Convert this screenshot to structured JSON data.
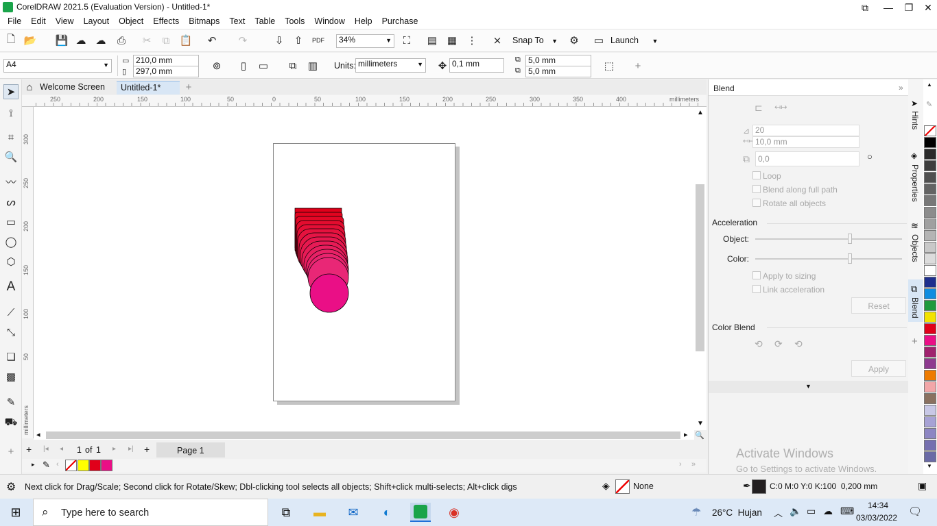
{
  "app": {
    "title": "CorelDRAW 2021.5 (Evaluation Version) - Untitled-1*",
    "brand_color": "#1aa44a"
  },
  "menu": [
    "File",
    "Edit",
    "View",
    "Layout",
    "Object",
    "Effects",
    "Bitmaps",
    "Text",
    "Table",
    "Tools",
    "Window",
    "Help",
    "Purchase"
  ],
  "toolbar": {
    "zoom": "34%",
    "snap_to": "Snap To",
    "launch": "Launch"
  },
  "propbar": {
    "page_size": "A4",
    "width": "210,0 mm",
    "height": "297,0 mm",
    "units_label": "Units:",
    "units": "millimeters",
    "nudge": "0,1 mm",
    "dup_x": "5,0 mm",
    "dup_y": "5,0 mm"
  },
  "tabs": {
    "welcome": "Welcome Screen",
    "doc": "Untitled-1*"
  },
  "ruler": {
    "unit": "millimeters",
    "h_ticks": [
      "250",
      "200",
      "150",
      "100",
      "50",
      "0",
      "50",
      "100",
      "150",
      "200",
      "250",
      "300",
      "350",
      "400"
    ],
    "v_ticks": [
      "300",
      "250",
      "200",
      "150",
      "100",
      "50"
    ],
    "v_unit": "millimeters"
  },
  "pagenav": {
    "current": "1",
    "of": "of",
    "total": "1",
    "page_tab": "Page 1"
  },
  "docker": {
    "title": "Blend",
    "steps": "20",
    "spacing": "10,0 mm",
    "rotation": "0,0",
    "loop": "Loop",
    "along_path": "Blend along full path",
    "rotate_all": "Rotate all objects",
    "acceleration": "Acceleration",
    "object_label": "Object:",
    "color_label": "Color:",
    "apply_sizing": "Apply to sizing",
    "link_accel": "Link acceleration",
    "reset": "Reset",
    "color_blend": "Color Blend",
    "apply": "Apply",
    "watermark_title": "Activate Windows",
    "watermark_sub": "Go to Settings to activate Windows."
  },
  "side_tabs": [
    "Hints",
    "Properties",
    "Objects",
    "Blend"
  ],
  "palette_colors": [
    "#000000",
    "#2b2b2b",
    "#3d3d3d",
    "#505050",
    "#646464",
    "#787878",
    "#8c8c8c",
    "#a0a0a0",
    "#b4b4b4",
    "#c8c8c8",
    "#dcdcdc",
    "#ffffff",
    "#1d2f8e",
    "#0f8de0",
    "#1e9a3c",
    "#f2e200",
    "#e0001a",
    "#ea0f86",
    "#a0226e",
    "#8e3a8f",
    "#ee7b00",
    "#f2a6a8",
    "#8a7160",
    "#c8c8e6",
    "#a7a2d5",
    "#8d86c3",
    "#7670b0",
    "#6a6aa6"
  ],
  "doc_palette": [
    "#ffff00",
    "#e0001a",
    "#ea0f86"
  ],
  "status": {
    "hint": "Next click for Drag/Scale; Second click for Rotate/Skew; Dbl-clicking tool selects all objects; Shift+click multi-selects; Alt+click digs",
    "fill": "None",
    "outline": "C:0 M:0 Y:0 K:100  0,200 mm"
  },
  "taskbar": {
    "search": "Type here to search",
    "weather": "26°C  Hujan",
    "time": "14:34",
    "date": "03/03/2022"
  }
}
